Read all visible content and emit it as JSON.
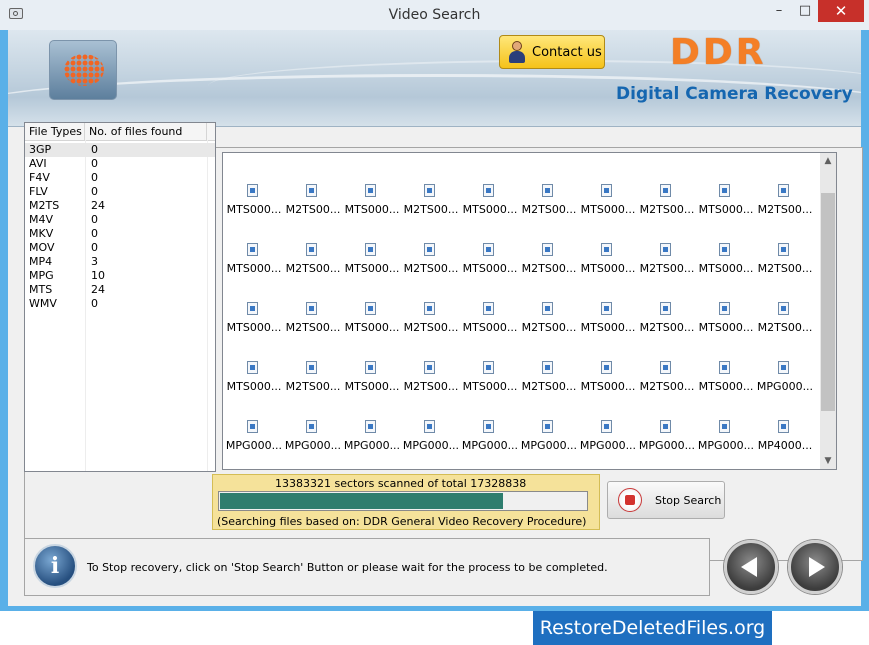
{
  "window": {
    "title": "Video Search",
    "minimize_glyph": "–",
    "maximize_glyph": "□",
    "close_glyph": "✕"
  },
  "header": {
    "contact_label": "Contact us",
    "brand": "DDR",
    "subtitle": "Digital Camera Recovery"
  },
  "file_types": {
    "col_type": "File Types",
    "col_count": "No. of files found",
    "rows": [
      {
        "type": "3GP",
        "count": "0"
      },
      {
        "type": "AVI",
        "count": "0"
      },
      {
        "type": "F4V",
        "count": "0"
      },
      {
        "type": "FLV",
        "count": "0"
      },
      {
        "type": "M2TS",
        "count": "24"
      },
      {
        "type": "M4V",
        "count": "0"
      },
      {
        "type": "MKV",
        "count": "0"
      },
      {
        "type": "MOV",
        "count": "0"
      },
      {
        "type": "MP4",
        "count": "3"
      },
      {
        "type": "MPG",
        "count": "10"
      },
      {
        "type": "MTS",
        "count": "24"
      },
      {
        "type": "WMV",
        "count": "0"
      }
    ]
  },
  "files": {
    "rows": [
      [
        "MTS000...",
        "M2TS00...",
        "MTS000...",
        "M2TS00...",
        "MTS000...",
        "M2TS00...",
        "MTS000...",
        "M2TS00...",
        "MTS000...",
        "M2TS00..."
      ],
      [
        "MTS000...",
        "M2TS00...",
        "MTS000...",
        "M2TS00...",
        "MTS000...",
        "M2TS00...",
        "MTS000...",
        "M2TS00...",
        "MTS000...",
        "M2TS00..."
      ],
      [
        "MTS000...",
        "M2TS00...",
        "MTS000...",
        "M2TS00...",
        "MTS000...",
        "M2TS00...",
        "MTS000...",
        "M2TS00...",
        "MTS000...",
        "M2TS00..."
      ],
      [
        "MTS000...",
        "M2TS00...",
        "MTS000...",
        "M2TS00...",
        "MTS000...",
        "M2TS00...",
        "MTS000...",
        "M2TS00...",
        "MTS000...",
        "MPG000..."
      ],
      [
        "MPG000...",
        "MPG000...",
        "MPG000...",
        "MPG000...",
        "MPG000...",
        "MPG000...",
        "MPG000...",
        "MPG000...",
        "MPG000...",
        "MP4000..."
      ]
    ]
  },
  "progress": {
    "text": "13383321 sectors scanned of total 17328838",
    "fraction": 0.7724,
    "note": "(Searching files based on:  DDR General Video Recovery Procedure)"
  },
  "stop_button": "Stop Search",
  "status": {
    "message": "To Stop recovery, click on 'Stop Search' Button or please wait for the process to be completed."
  },
  "footer_brand": "RestoreDeletedFiles.org",
  "icons": {
    "info": "info-icon",
    "back": "back-arrow-icon",
    "next": "next-arrow-icon",
    "stop": "stop-icon"
  },
  "colors": {
    "brand_orange": "#f47f26",
    "subtitle_blue": "#1566b0",
    "progress_fill": "#2e7d6e",
    "progress_panel": "#f5e29a",
    "footer_blue": "#1e6fc0"
  }
}
